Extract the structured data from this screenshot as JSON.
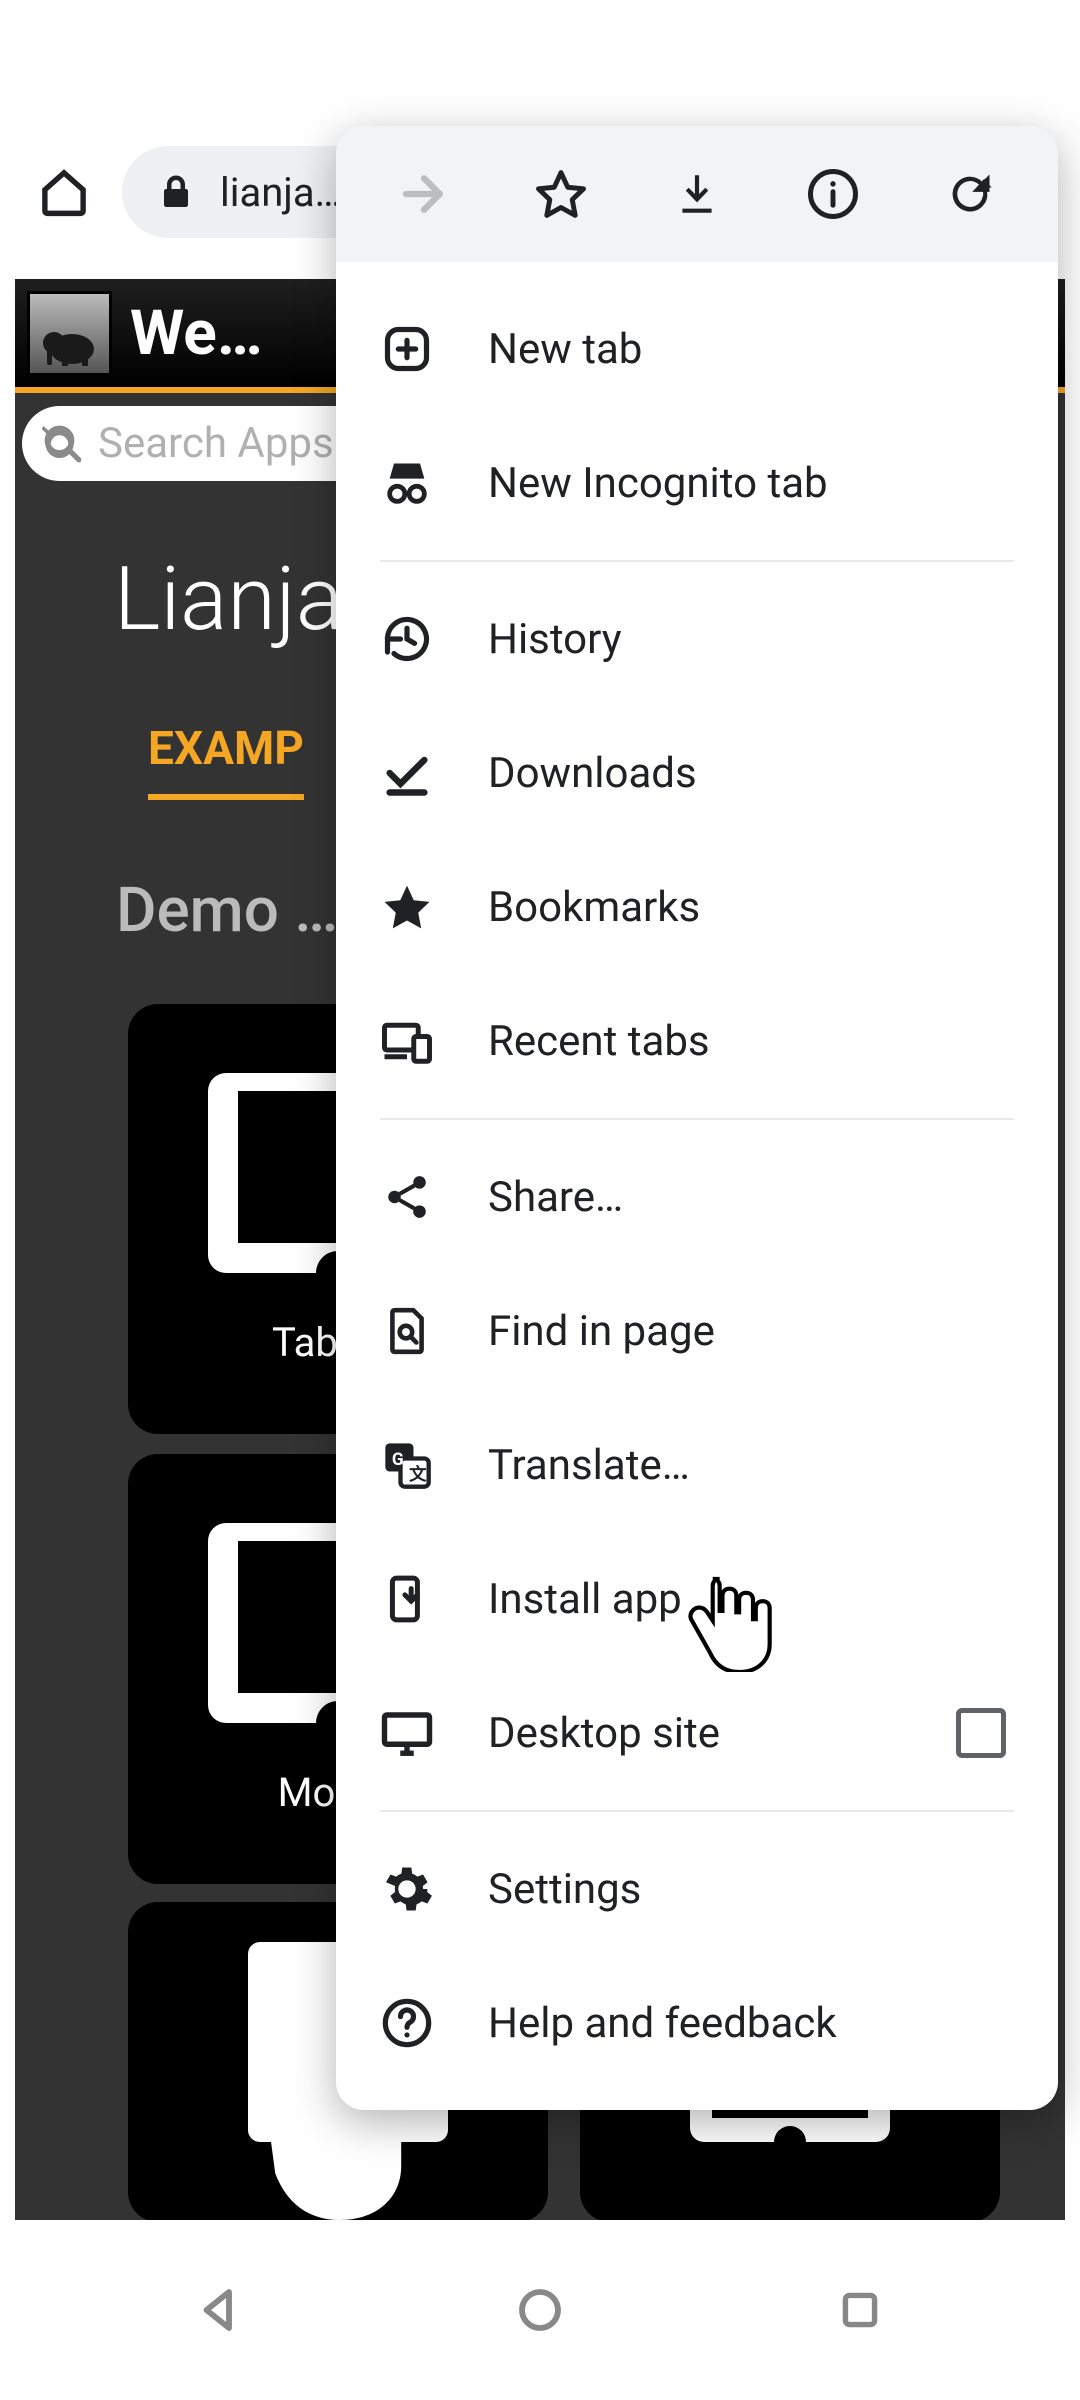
{
  "toolbar": {
    "url": "lianja…"
  },
  "page": {
    "site_title": "We…",
    "search_placeholder": "Search Apps",
    "page_title": "Lianja",
    "tab": "EXAMP",
    "section_title": "Demo …",
    "tiles": {
      "tile1_label": "Tabbed",
      "tile2_label": "Mobile "
    }
  },
  "menu": {
    "items": [
      "New tab",
      "New Incognito tab",
      "History",
      "Downloads",
      "Bookmarks",
      "Recent tabs",
      "Share…",
      "Find in page",
      "Translate…",
      "Install app",
      "Desktop site",
      "Settings",
      "Help and feedback"
    ]
  }
}
